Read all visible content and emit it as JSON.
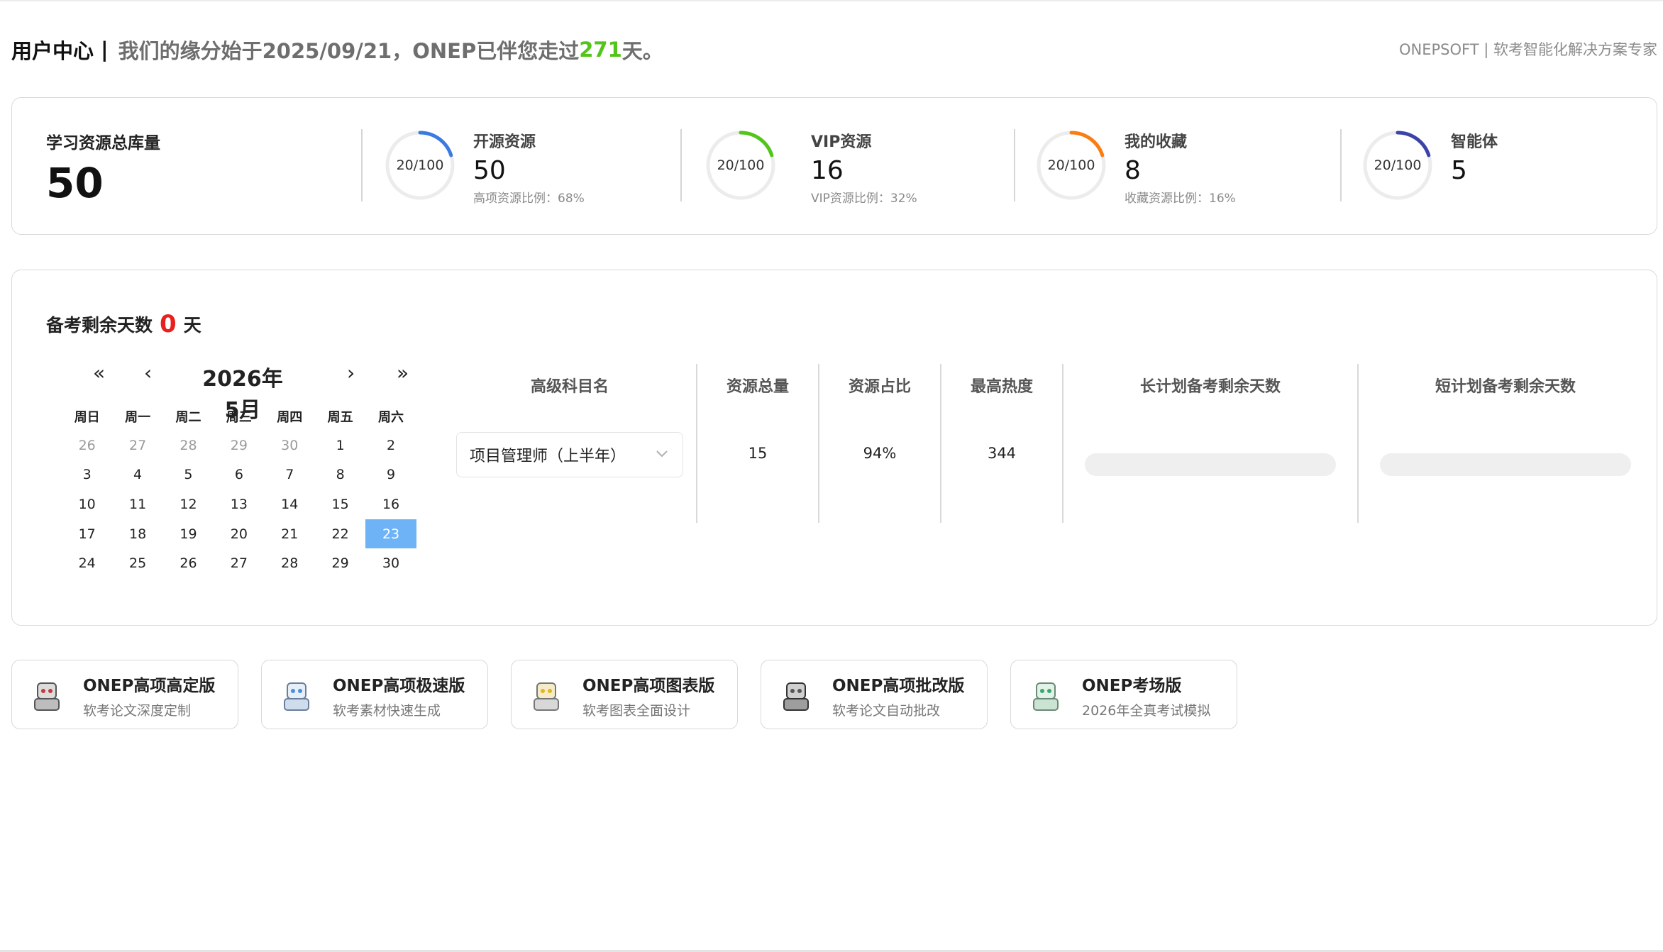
{
  "header": {
    "title": "用户中心",
    "separator": "|",
    "greeting_prefix": "我们的缘分始于2025/09/21，ONEP已伴您走过",
    "days": "271",
    "greeting_suffix": "天。",
    "brand": "ONEPSOFT | 软考智能化解决方案专家"
  },
  "stats": {
    "total_label": "学习资源总库量",
    "total_value": "50",
    "items": [
      {
        "ring_text": "20/100",
        "progress": 0.2,
        "color": "#3b7be0",
        "name": "开源资源",
        "value": "50",
        "ratio": "高项资源比例：68%"
      },
      {
        "ring_text": "20/100",
        "progress": 0.2,
        "color": "#52c41a",
        "name": "VIP资源",
        "value": "16",
        "ratio": "VIP资源比例：32%"
      },
      {
        "ring_text": "20/100",
        "progress": 0.2,
        "color": "#fa7d14",
        "name": "我的收藏",
        "value": "8",
        "ratio": "收藏资源比例：16%"
      },
      {
        "ring_text": "20/100",
        "progress": 0.2,
        "color": "#3c43a8",
        "name": "智能体",
        "value": "5",
        "ratio": ""
      }
    ]
  },
  "exam": {
    "title_prefix": "备考剩余天数",
    "days": "0",
    "title_suffix": "天",
    "calendar": {
      "prev_year": "«",
      "prev_month": "‹",
      "month_label": "2026年5月",
      "next_month": "›",
      "next_year": "»",
      "weekdays": [
        "周日",
        "周一",
        "周二",
        "周三",
        "周四",
        "周五",
        "周六"
      ],
      "days": [
        [
          "26",
          "27",
          "28",
          "29",
          "30",
          "1",
          "2"
        ],
        [
          "3",
          "4",
          "5",
          "6",
          "7",
          "8",
          "9"
        ],
        [
          "10",
          "11",
          "12",
          "13",
          "14",
          "15",
          "16"
        ],
        [
          "17",
          "18",
          "19",
          "20",
          "21",
          "22",
          "23"
        ],
        [
          "24",
          "25",
          "26",
          "27",
          "28",
          "29",
          "30"
        ]
      ],
      "selected_day": "23"
    },
    "table": {
      "headers": {
        "subject": "高级科目名",
        "total": "资源总量",
        "share": "资源占比",
        "heat": "最高热度",
        "long_plan": "长计划备考剩余天数",
        "short_plan": "短计划备考剩余天数"
      },
      "row": {
        "subject": "项目管理师（上半年）",
        "total": "15",
        "share": "94%",
        "heat": "344",
        "long_plan_progress": 0,
        "short_plan_progress": 0
      }
    }
  },
  "products": [
    {
      "title": "ONEP高项高定版",
      "subtitle": "软考论文深度定制",
      "icon": "robot-mascot-icon",
      "accent": "#c83a3a"
    },
    {
      "title": "ONEP高项极速版",
      "subtitle": "软考素材快速生成",
      "icon": "robot-mascot-icon",
      "accent": "#4a90d9"
    },
    {
      "title": "ONEP高项图表版",
      "subtitle": "软考图表全面设计",
      "icon": "robot-mascot-icon",
      "accent": "#e6b422"
    },
    {
      "title": "ONEP高项批改版",
      "subtitle": "软考论文自动批改",
      "icon": "robot-mascot-icon",
      "accent": "#555555"
    },
    {
      "title": "ONEP考场版",
      "subtitle": "2026年全真考试模拟",
      "icon": "robot-mascot-icon",
      "accent": "#3aa86b"
    }
  ]
}
